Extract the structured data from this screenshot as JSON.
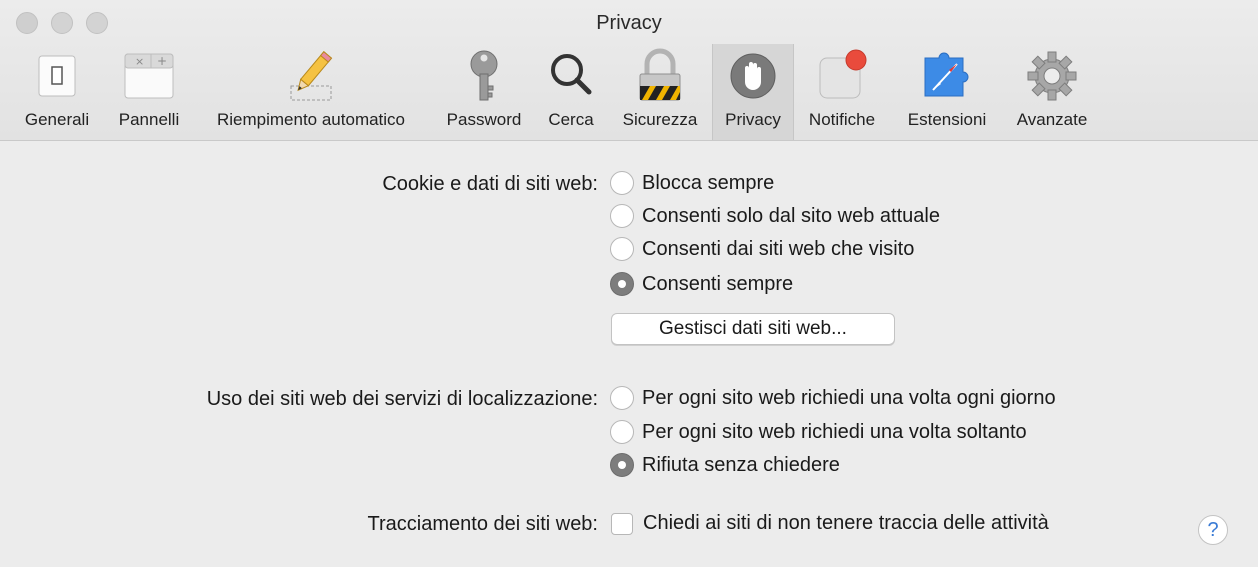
{
  "window": {
    "title": "Privacy"
  },
  "toolbar": {
    "items": [
      {
        "label": "Generali",
        "icon": "general-switch-icon"
      },
      {
        "label": "Pannelli",
        "icon": "tabs-icon"
      },
      {
        "label": "Riempimento automatico",
        "icon": "pencil-icon"
      },
      {
        "label": "Password",
        "icon": "key-icon"
      },
      {
        "label": "Cerca",
        "icon": "magnifier-icon"
      },
      {
        "label": "Sicurezza",
        "icon": "lock-icon"
      },
      {
        "label": "Privacy",
        "icon": "hand-icon",
        "selected": true
      },
      {
        "label": "Notifiche",
        "icon": "notification-icon"
      },
      {
        "label": "Estensioni",
        "icon": "puzzle-icon"
      },
      {
        "label": "Avanzate",
        "icon": "gear-icon"
      }
    ]
  },
  "cookies": {
    "label": "Cookie e dati di siti web:",
    "options": [
      {
        "label": "Blocca sempre",
        "selected": false
      },
      {
        "label": "Consenti solo dal sito web attuale",
        "selected": false
      },
      {
        "label": "Consenti dai siti web che visito",
        "selected": false
      },
      {
        "label": "Consenti sempre",
        "selected": true
      }
    ],
    "manage_button": "Gestisci dati siti web..."
  },
  "location": {
    "label": "Uso dei siti web dei servizi di localizzazione:",
    "options": [
      {
        "label": "Per ogni sito web richiedi una volta ogni giorno",
        "selected": false
      },
      {
        "label": "Per ogni sito web richiedi una volta soltanto",
        "selected": false
      },
      {
        "label": "Rifiuta senza chiedere",
        "selected": true
      }
    ]
  },
  "tracking": {
    "label": "Tracciamento dei siti web:",
    "checkbox_label": "Chiedi ai siti di non tenere traccia delle attività",
    "checked": false
  },
  "help": {
    "glyph": "?"
  },
  "colors": {
    "background": "#ececec",
    "selected_tab": "#d6d6d6",
    "help_accent": "#3a7bd5"
  }
}
